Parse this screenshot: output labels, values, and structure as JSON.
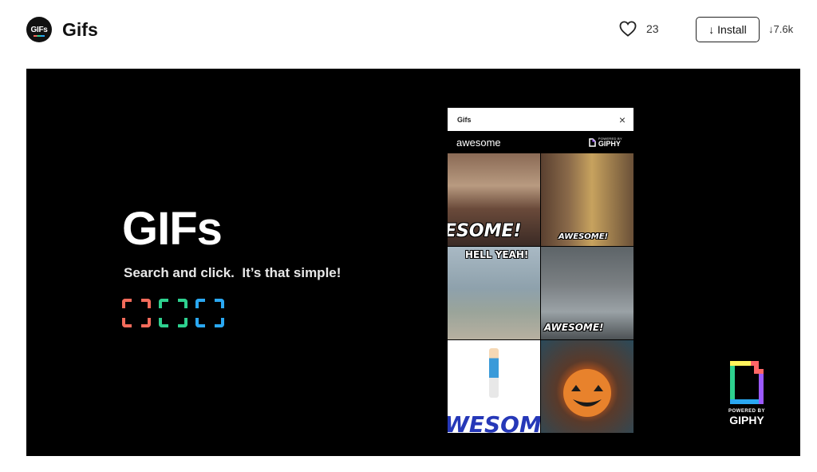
{
  "app": {
    "logo_text": "GIFs",
    "title": "Gifs"
  },
  "header": {
    "like_count": "23",
    "install_label": "↓ Install",
    "downloads": "↓7.6k"
  },
  "banner": {
    "title": "GIFs",
    "subtitle": "Search and click.  It’s that simple!",
    "bracket_colors": [
      "#f26b5b",
      "#2ed18f",
      "#2aa8f2"
    ],
    "giphy_powered_small": "POWERED BY",
    "giphy_powered_big": "GIPHY"
  },
  "panel": {
    "title": "Gifs",
    "close_icon": "×",
    "search_value": "awesome",
    "powered_small": "POWERED BY",
    "powered_big": "GIPHY",
    "tiles": [
      {
        "label": "ESOME!"
      },
      {
        "label": "AWESOME!"
      },
      {
        "label": "HELL YEAH!"
      },
      {
        "label": "AWESOME!"
      },
      {
        "label": "WESOM"
      },
      {
        "label": ""
      }
    ]
  }
}
